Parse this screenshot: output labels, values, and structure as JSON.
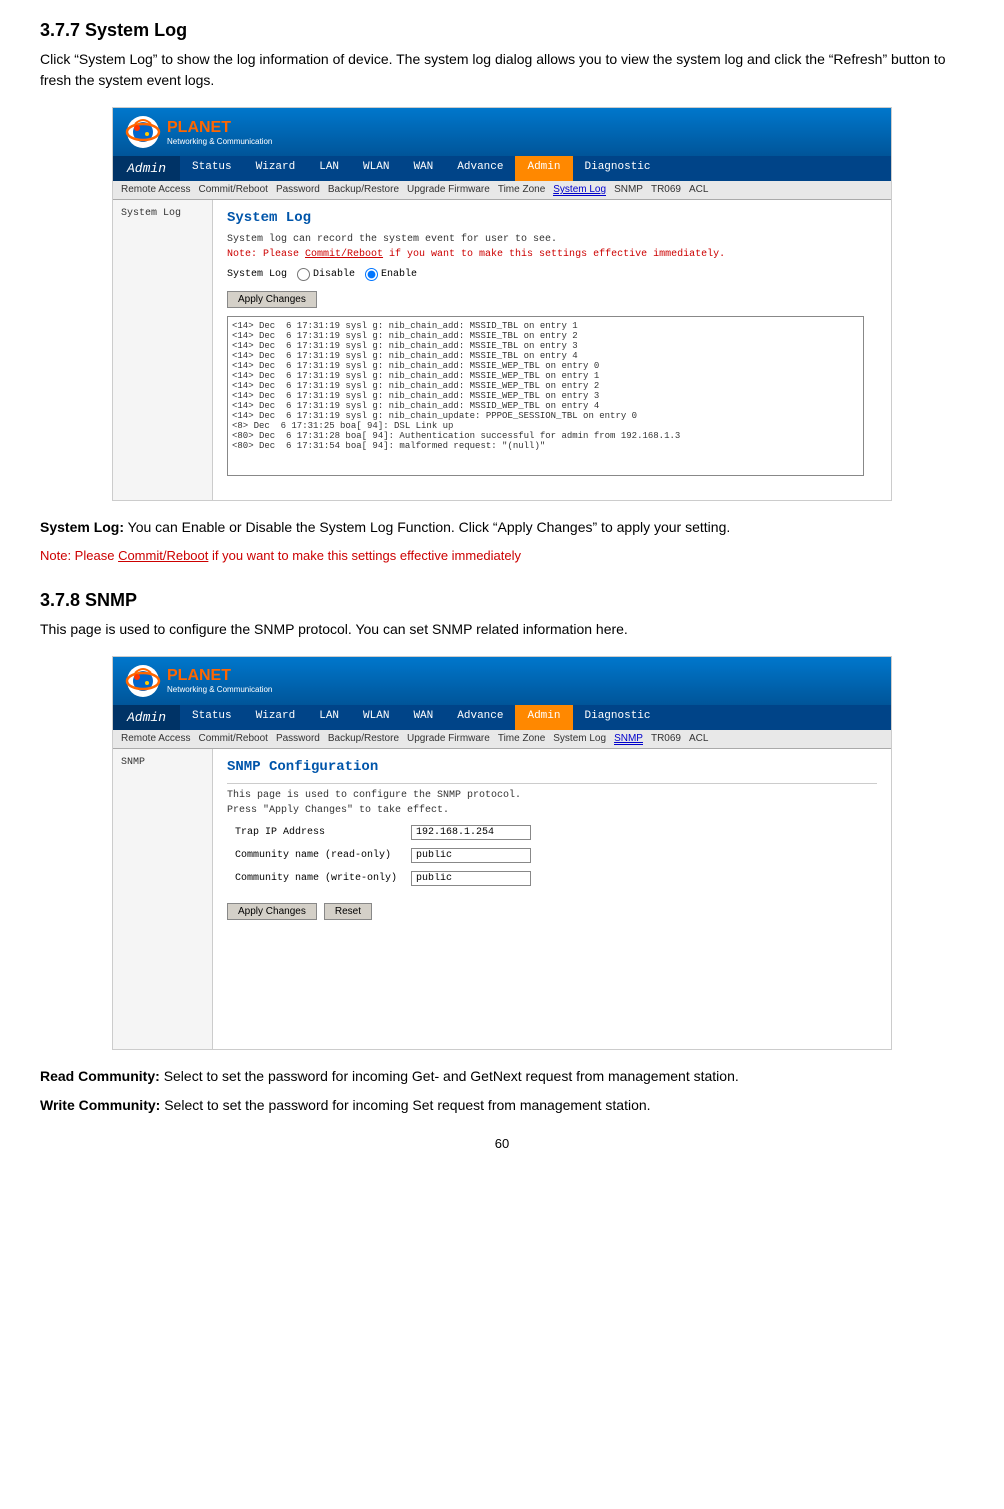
{
  "section1": {
    "heading": "3.7.7 System Log",
    "description": "Click “System Log” to show the log information of device. The system log dialog allows you to view the system log and click the “Refresh” button to fresh the system event logs."
  },
  "systemlog_screenshot": {
    "logo_text": "PLANET",
    "logo_sub": "Networking & Communication",
    "nav_items": [
      "Admin",
      "Status",
      "Wizard",
      "LAN",
      "WLAN",
      "WAN",
      "Advance",
      "Admin",
      "Diagnostic"
    ],
    "nav_active": "Admin",
    "sub_nav_items": [
      "Remote Access",
      "Commit/Reboot",
      "Password",
      "Backup/Restore",
      "Upgrade Firmware",
      "Time Zone",
      "System Log",
      "SNMP",
      "TR069",
      "ACL"
    ],
    "sub_nav_active": "System Log",
    "sidebar_label": "System Log",
    "page_title": "System Log",
    "page_desc": "System log can record the system event for user to see.",
    "note": "Note: Please Commit/Reboot if you want to make this settings effective immediately.",
    "form_label": "System Log",
    "radio_disable": "Disable",
    "radio_enable": "Enable",
    "apply_btn": "Apply Changes",
    "log_content": "<14> Dec  6 17:31:19 sysl g: nib_chain_add: MSSID_TBL on entry 1\n<14> Dec  6 17:31:19 sysl g: nib_chain_add: MSSIE_TBL on entry 2\n<14> Dec  6 17:31:19 sysl g: nib_chain_add: MSSIE_TBL on entry 3\n<14> Dec  6 17:31:19 sysl g: nib_chain_add: MSSIE_TBL on entry 4\n<14> Dec  6 17:31:19 sysl g: nib_chain_add: MSSIE_WEP_TBL on entry 0\n<14> Dec  6 17:31:19 sysl g: nib_chain_add: MSSIE_WEP_TBL on entry 1\n<14> Dec  6 17:31:19 sysl g: nib_chain_add: MSSIE_WEP_TBL on entry 2\n<14> Dec  6 17:31:19 sysl g: nib_chain_add: MSSIE_WEP_TBL on entry 3\n<14> Dec  6 17:31:19 sysl g: nib_chain_add: MSSID_WEP_TBL on entry 4\n<14> Dec  6 17:31:19 sysl g: nib_chain_update: PPPOE_SESSION_TBL on entry 0\n<8> Dec  6 17:31:25 boa[ 94]: DSL Link up\n<80> Dec  6 17:31:28 boa[ 94]: Authentication successful for admin from 192.168.1.3\n<80> Dec  6 17:31:54 boa[ 94]: malformed request: \"(null)\""
  },
  "section1_after": {
    "system_log_label": "System Log:",
    "system_log_desc": "You can Enable or Disable the System Log Function. Click “Apply Changes” to apply your setting.",
    "note_label": "Note: Please",
    "note_link": "Commit/Reboot",
    "note_rest": "if you want to make this settings effective immediately"
  },
  "section2": {
    "heading": "3.7.8 SNMP",
    "description": "This page is used to configure the SNMP protocol. You can set SNMP related information here."
  },
  "snmp_screenshot": {
    "logo_text": "PLANET",
    "logo_sub": "Networking & Communication",
    "nav_items": [
      "Admin",
      "Status",
      "Wizard",
      "LAN",
      "WLAN",
      "WAN",
      "Advance",
      "Admin",
      "Diagnostic"
    ],
    "nav_active": "Admin",
    "sub_nav_items": [
      "Remote Access",
      "Commit/Reboot",
      "Password",
      "Backup/Restore",
      "Upgrade Firmware",
      "Time Zone",
      "System Log",
      "SNMP",
      "TR069",
      "ACL"
    ],
    "sub_nav_active": "SNMP",
    "sidebar_label": "SNMP",
    "page_title": "SNMP Configuration",
    "page_desc1": "This page is used to configure the SNMP protocol.",
    "page_desc2": "Press \"Apply Changes\" to take effect.",
    "trap_ip_label": "Trap IP Address",
    "trap_ip_value": "192.168.1.254",
    "community_read_label": "Community name (read-only)",
    "community_read_value": "public",
    "community_write_label": "Community name (write-only)",
    "community_write_value": "public",
    "apply_btn": "Apply Changes",
    "reset_btn": "Reset"
  },
  "section2_after": {
    "read_community_label": "Read Community:",
    "read_community_desc": "Select to set the password for incoming Get- and GetNext request from management station.",
    "write_community_label": "Write Community:",
    "write_community_desc": "Select to set the password for incoming Set request from management station."
  },
  "page_number": "60"
}
